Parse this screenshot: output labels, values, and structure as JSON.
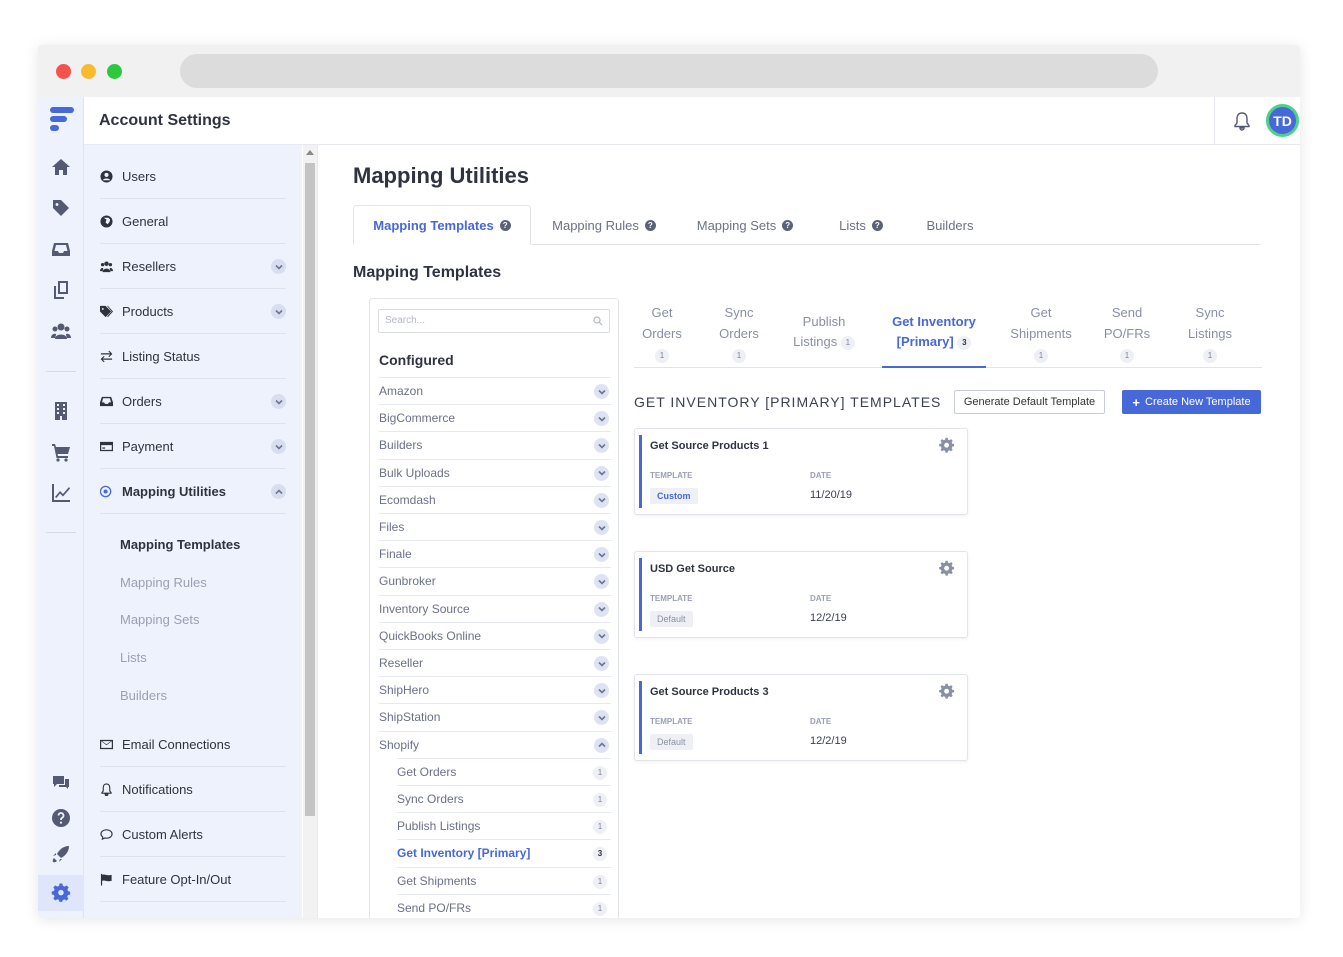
{
  "header": {
    "title": "Account Settings",
    "avatar_initials": "TD",
    "logo_color": "#4668d8"
  },
  "sidebar": {
    "items": [
      {
        "label": "Users",
        "icon": "user-circle-icon",
        "expandable": false
      },
      {
        "label": "General",
        "icon": "globe-icon",
        "expandable": false
      },
      {
        "label": "Resellers",
        "icon": "users-icon",
        "expandable": true
      },
      {
        "label": "Products",
        "icon": "tags-icon",
        "expandable": true
      },
      {
        "label": "Listing Status",
        "icon": "exchange-icon",
        "expandable": false
      },
      {
        "label": "Orders",
        "icon": "inbox-icon",
        "expandable": true
      },
      {
        "label": "Payment",
        "icon": "credit-card-icon",
        "expandable": true
      },
      {
        "label": "Mapping Utilities",
        "icon": "mapping-icon",
        "expandable": true,
        "active": true
      },
      {
        "label": "Email Connections",
        "icon": "envelope-icon",
        "expandable": false
      },
      {
        "label": "Notifications",
        "icon": "bell-icon",
        "expandable": false
      },
      {
        "label": "Custom Alerts",
        "icon": "comment-icon",
        "expandable": false
      },
      {
        "label": "Feature Opt-In/Out",
        "icon": "flag-icon",
        "expandable": false
      }
    ],
    "sub_items": [
      "Mapping Templates",
      "Mapping Rules",
      "Mapping Sets",
      "Lists",
      "Builders"
    ],
    "active_sub": "Mapping Templates"
  },
  "main": {
    "title": "Mapping Utilities",
    "tabs": [
      {
        "label": "Mapping Templates",
        "help": true
      },
      {
        "label": "Mapping Rules",
        "help": true
      },
      {
        "label": "Mapping Sets",
        "help": true
      },
      {
        "label": "Lists",
        "help": true
      },
      {
        "label": "Builders",
        "help": false
      }
    ],
    "section_title": "Mapping Templates"
  },
  "list_panel": {
    "search_placeholder": "Search...",
    "heading": "Configured",
    "rows": [
      "Amazon",
      "BigCommerce",
      "Builders",
      "Bulk Uploads",
      "Ecomdash",
      "Files",
      "Finale",
      "Gunbroker",
      "Inventory Source",
      "QuickBooks Online",
      "Reseller",
      "ShipHero",
      "ShipStation",
      "Shopify"
    ],
    "expanded_row": "Shopify",
    "sub_rows": [
      {
        "label": "Get Orders",
        "count": "1"
      },
      {
        "label": "Sync Orders",
        "count": "1"
      },
      {
        "label": "Publish Listings",
        "count": "1"
      },
      {
        "label": "Get Inventory [Primary]",
        "count": "3",
        "active": true
      },
      {
        "label": "Get Shipments",
        "count": "1"
      },
      {
        "label": "Send PO/FRs",
        "count": "1"
      }
    ]
  },
  "operation_tabs": [
    {
      "line1": "Get",
      "line2": "Orders",
      "count": "1"
    },
    {
      "line1": "Sync",
      "line2": "Orders",
      "count": "1"
    },
    {
      "line1": "Publish",
      "line2": "Listings",
      "count": "1"
    },
    {
      "line1": "Get Inventory",
      "line2": "[Primary]",
      "count": "3",
      "active": true
    },
    {
      "line1": "Get",
      "line2": "Shipments",
      "count": "1"
    },
    {
      "line1": "Send",
      "line2": "PO/FRs",
      "count": "1"
    },
    {
      "line1": "Sync",
      "line2": "Listings",
      "count": "1"
    }
  ],
  "templates_section": {
    "title": "GET INVENTORY [PRIMARY] TEMPLATES",
    "generate_button": "Generate Default Template",
    "create_button": "Create New Template",
    "template_label": "TEMPLATE",
    "date_label": "DATE"
  },
  "templates": [
    {
      "name": "Get Source Products 1",
      "type": "Custom",
      "date": "11/20/19"
    },
    {
      "name": "USD Get Source",
      "type": "Default",
      "date": "12/2/19"
    },
    {
      "name": "Get Source Products 3",
      "type": "Default",
      "date": "12/2/19"
    }
  ],
  "colors": {
    "accent": "#4668d8",
    "sidebar_bg": "#eef2fc",
    "avatar_ring": "#4fd18b"
  }
}
